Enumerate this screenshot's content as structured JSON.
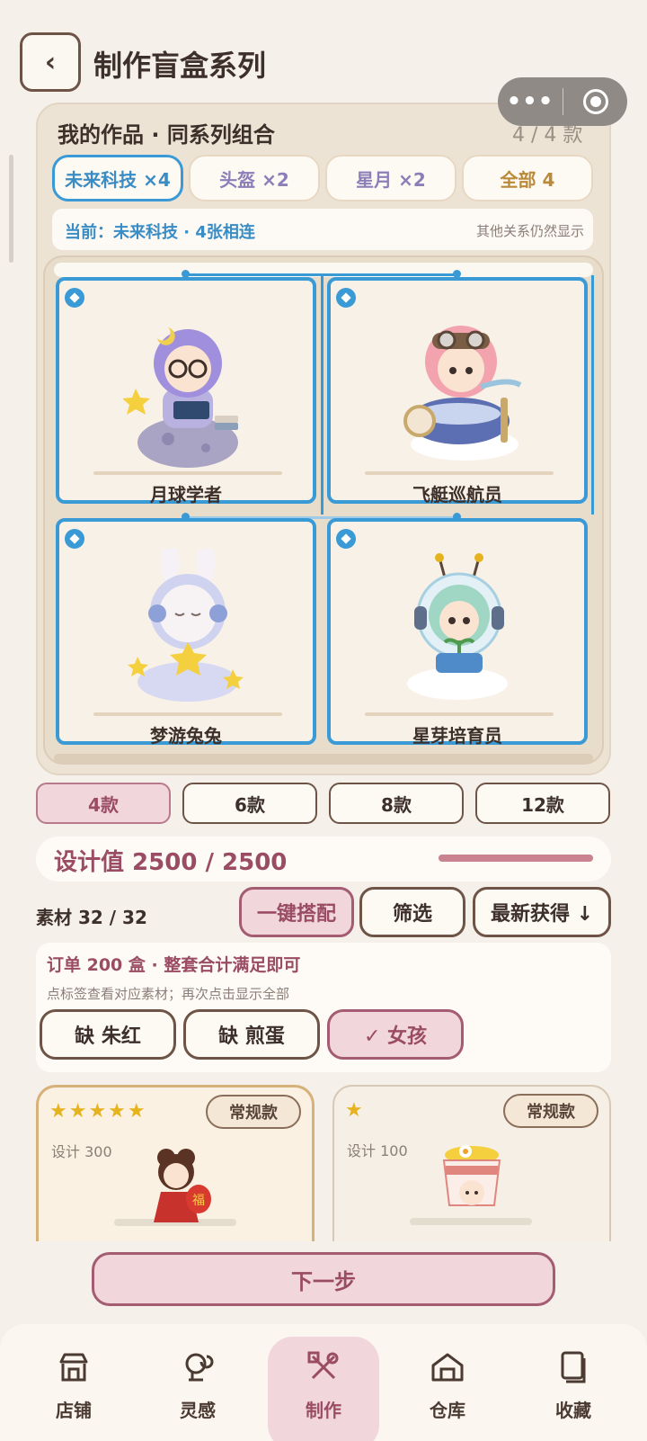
{
  "header": {
    "title": "制作盲盒系列",
    "back_icon": "‹"
  },
  "capsule": {
    "more_label": "•••"
  },
  "works": {
    "title": "我的作品 · 同系列组合",
    "count": "4 / 4 款",
    "segments": [
      {
        "label": "未来科技 ×4",
        "active": true
      },
      {
        "label": "头盔 ×2",
        "active": false
      },
      {
        "label": "星月 ×2",
        "active": false
      },
      {
        "label": "全部 4",
        "active": false
      }
    ],
    "current": "当前：未来科技 · 4张相连",
    "current_note": "其他关系仍然显示",
    "cards": [
      {
        "name": "月球学者"
      },
      {
        "name": "飞艇巡航员"
      },
      {
        "name": "梦游兔兔"
      },
      {
        "name": "星芽培育员"
      }
    ]
  },
  "counts": [
    {
      "label": "4款",
      "active": true
    },
    {
      "label": "6款",
      "active": false
    },
    {
      "label": "8款",
      "active": false
    },
    {
      "label": "12款",
      "active": false
    }
  ],
  "design": {
    "label": "设计值 2500 / 2500",
    "progress": 1.0
  },
  "materials": {
    "label": "素材 32 / 32",
    "auto_match": "一键搭配",
    "filter": "筛选",
    "sort": "最新获得 ↓"
  },
  "order": {
    "title": "订单 200 盒 · 整套合计满足即可",
    "note": "点标签查看对应素材；再次点击显示全部",
    "tags": [
      {
        "label": "缺 朱红",
        "active": false
      },
      {
        "label": "缺 煎蛋",
        "active": false
      },
      {
        "label": "✓ 女孩",
        "active": true
      }
    ]
  },
  "material_cards": [
    {
      "stars": "★★★★★",
      "rating": 5,
      "kind": "常规款",
      "design": "设计 300"
    },
    {
      "stars": "★",
      "rating": 1,
      "kind": "常规款",
      "design": "设计 100"
    }
  ],
  "next_button": "下一步",
  "nav": [
    {
      "label": "店铺",
      "icon": "shop-icon",
      "active": false
    },
    {
      "label": "灵感",
      "icon": "inspiration-icon",
      "active": false
    },
    {
      "label": "制作",
      "icon": "craft-icon",
      "active": true
    },
    {
      "label": "仓库",
      "icon": "warehouse-icon",
      "active": false
    },
    {
      "label": "收藏",
      "icon": "collection-icon",
      "active": false
    }
  ],
  "colors": {
    "accent_blue": "#3a9ad6",
    "accent_pink": "#9b4c65",
    "pink_bg": "#f1d6dc",
    "background": "#f5f0e9"
  }
}
